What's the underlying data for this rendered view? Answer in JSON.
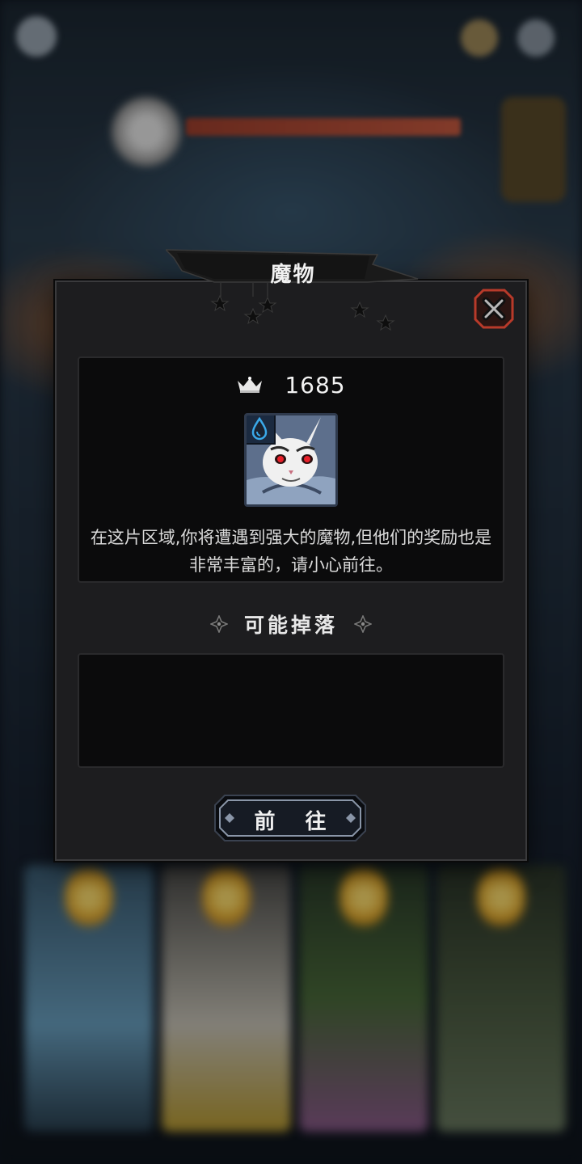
{
  "dialog": {
    "title": "魔物",
    "score": "1685",
    "description": "在这片区域,你将遭遇到强大的魔物,但他们的奖励也是非常丰富的，请小心前往。",
    "drops_title": "可能掉落",
    "go_button_label": "前 往"
  },
  "icons": {
    "crown": "crown-icon",
    "close": "close-icon",
    "water_element": "water-drop-icon",
    "diamond": "diamond-ornament-icon"
  },
  "colors": {
    "dialog_bg": "#1d1d1f",
    "panel_bg": "#0b0b0c",
    "close_accent": "#b83a2a",
    "text": "#f2f2f2"
  }
}
